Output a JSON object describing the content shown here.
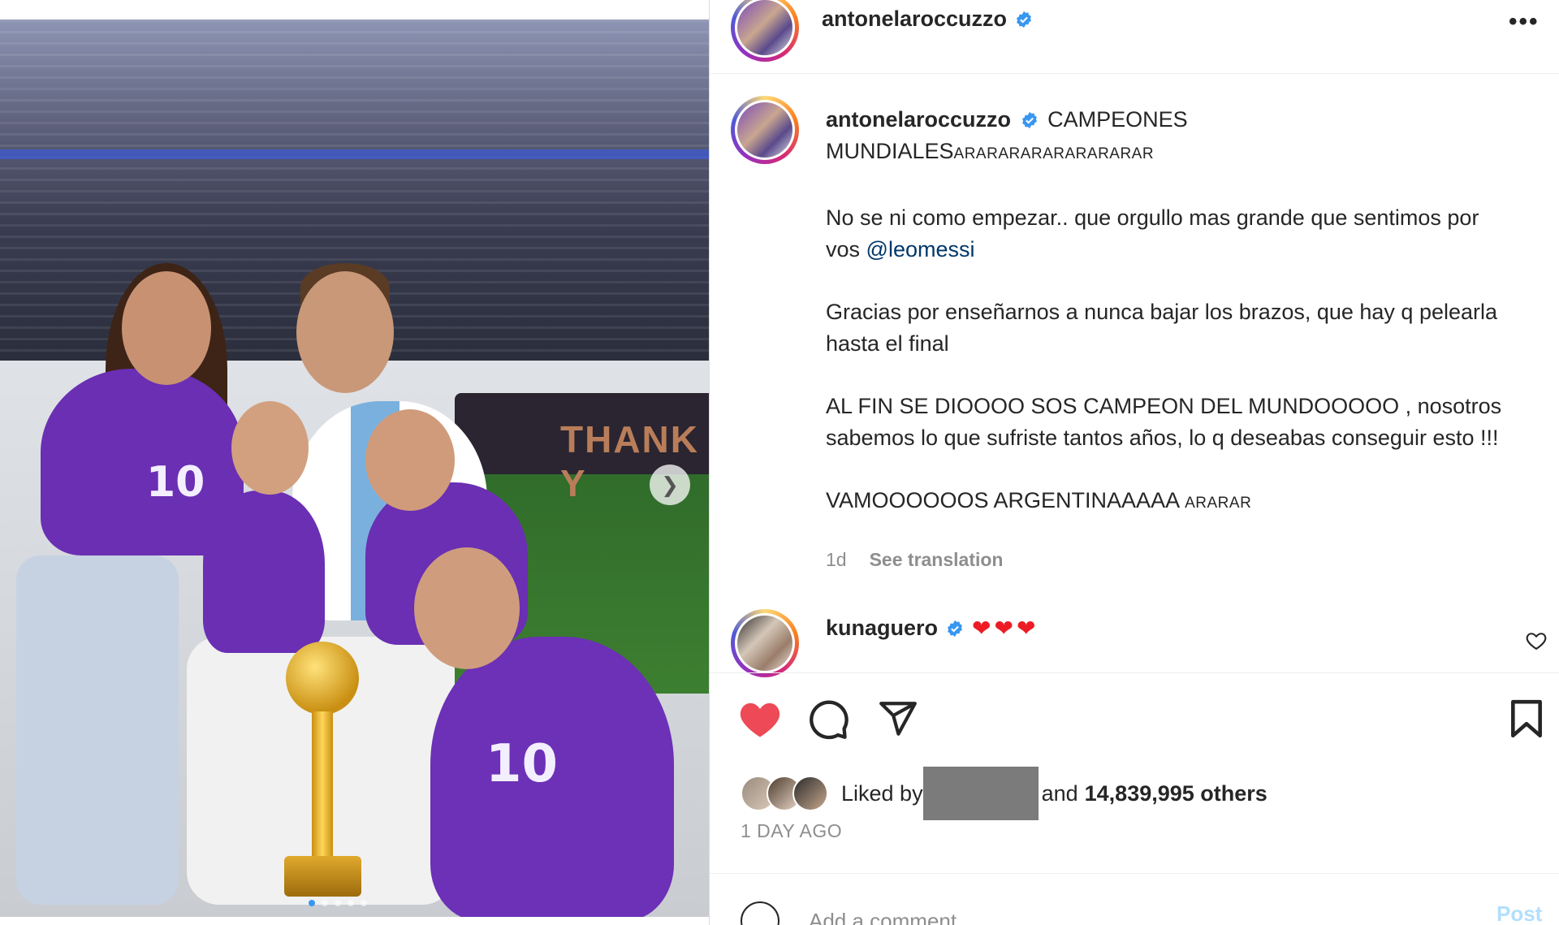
{
  "post": {
    "username": "antonelaroccuzzo",
    "menu_icon": "more-options-icon"
  },
  "caption": {
    "username": "antonelaroccuzzo",
    "title": "CAMPEONES MUNDIALES",
    "title_flags": "ARARARARARARARARAR",
    "line1": "No se ni como empezar.. que orgullo mas grande que sentimos por vos ",
    "mention": "@leomessi",
    "line2": "Gracias por enseñarnos a nunca bajar los brazos, que hay q pelearla hasta el final",
    "line3": "AL FIN SE DIOOOO SOS CAMPEON DEL MUNDOOOOO , nosotros sabemos lo que sufriste tantos años, lo q deseabas conseguir esto !!!",
    "line4": "VAMOOOOOOS ARGENTINAAAAA ",
    "line4_flags": "ARARAR",
    "age": "1d",
    "see_translation": "See translation"
  },
  "comment": {
    "username": "kunaguero",
    "text": "❤❤❤"
  },
  "likes": {
    "prefix": "Liked by",
    "middle": "and",
    "count_text": "14,839,995 others"
  },
  "timestamp": "1 DAY AGO",
  "add_comment": {
    "placeholder": "Add a comment...",
    "post_label": "Post"
  },
  "carousel": {
    "total_slides": 5,
    "active_slide": 1
  },
  "photo": {
    "banner_text": "THANK Y",
    "jersey_number": "10"
  },
  "colors": {
    "like_red": "#ed4956",
    "verified_blue": "#3897f0",
    "link_blue": "#00376b",
    "post_blue_disabled": "#b2dffc"
  }
}
